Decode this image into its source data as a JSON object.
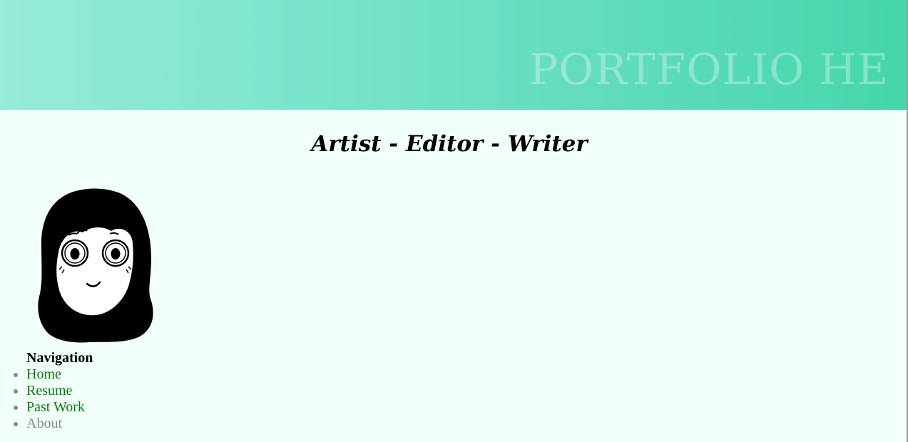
{
  "banner": {
    "text": "PORTFOLIO HE",
    "gradient_start": "#97ebd8",
    "gradient_end": "#45d6ab"
  },
  "tagline": "Artist - Editor - Writer",
  "nav": {
    "heading": "Navigation",
    "items": [
      {
        "label": "Home",
        "state": "link"
      },
      {
        "label": "Resume",
        "state": "link"
      },
      {
        "label": "Past Work",
        "state": "link"
      },
      {
        "label": "About",
        "state": "current"
      }
    ],
    "link_color": "#0a7d0a",
    "current_color": "#888888"
  },
  "colors": {
    "page_background": "#f1fff9"
  }
}
